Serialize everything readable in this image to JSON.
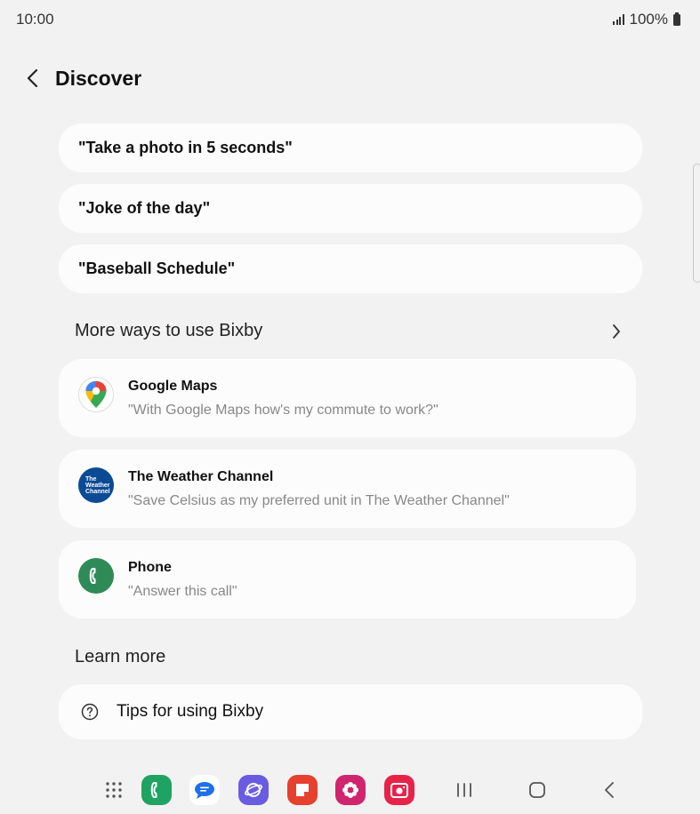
{
  "status_bar": {
    "time": "10:00",
    "battery": "100%"
  },
  "header": {
    "title": "Discover"
  },
  "phrases": [
    "\"Take a photo in 5 seconds\"",
    "\"Joke of the day\"",
    "\"Baseball Schedule\""
  ],
  "more_ways": {
    "title": "More ways to use Bixby",
    "apps": [
      {
        "name": "Google Maps",
        "example": "\"With Google Maps how's my commute to work?\"",
        "icon": "google-maps-icon"
      },
      {
        "name": "The Weather Channel",
        "example": "\"Save Celsius as my preferred unit in The Weather Channel\"",
        "icon": "weather-channel-icon",
        "icon_text": "The Weather Channel"
      },
      {
        "name": "Phone",
        "example": "\"Answer this call\"",
        "icon": "phone-icon"
      }
    ]
  },
  "learn_more": {
    "title": "Learn more",
    "tips_label": "Tips for using Bixby"
  },
  "dock": [
    "apps-grid-icon",
    "phone-app-icon",
    "messages-app-icon",
    "internet-app-icon",
    "notes-app-icon",
    "gallery-app-icon",
    "camera-app-icon"
  ],
  "colors": {
    "background": "#f2f2f2",
    "card": "#fcfcfc",
    "secondary_text": "#888888",
    "weather_blue": "#0b4a94",
    "phone_green": "#2e8b57"
  }
}
